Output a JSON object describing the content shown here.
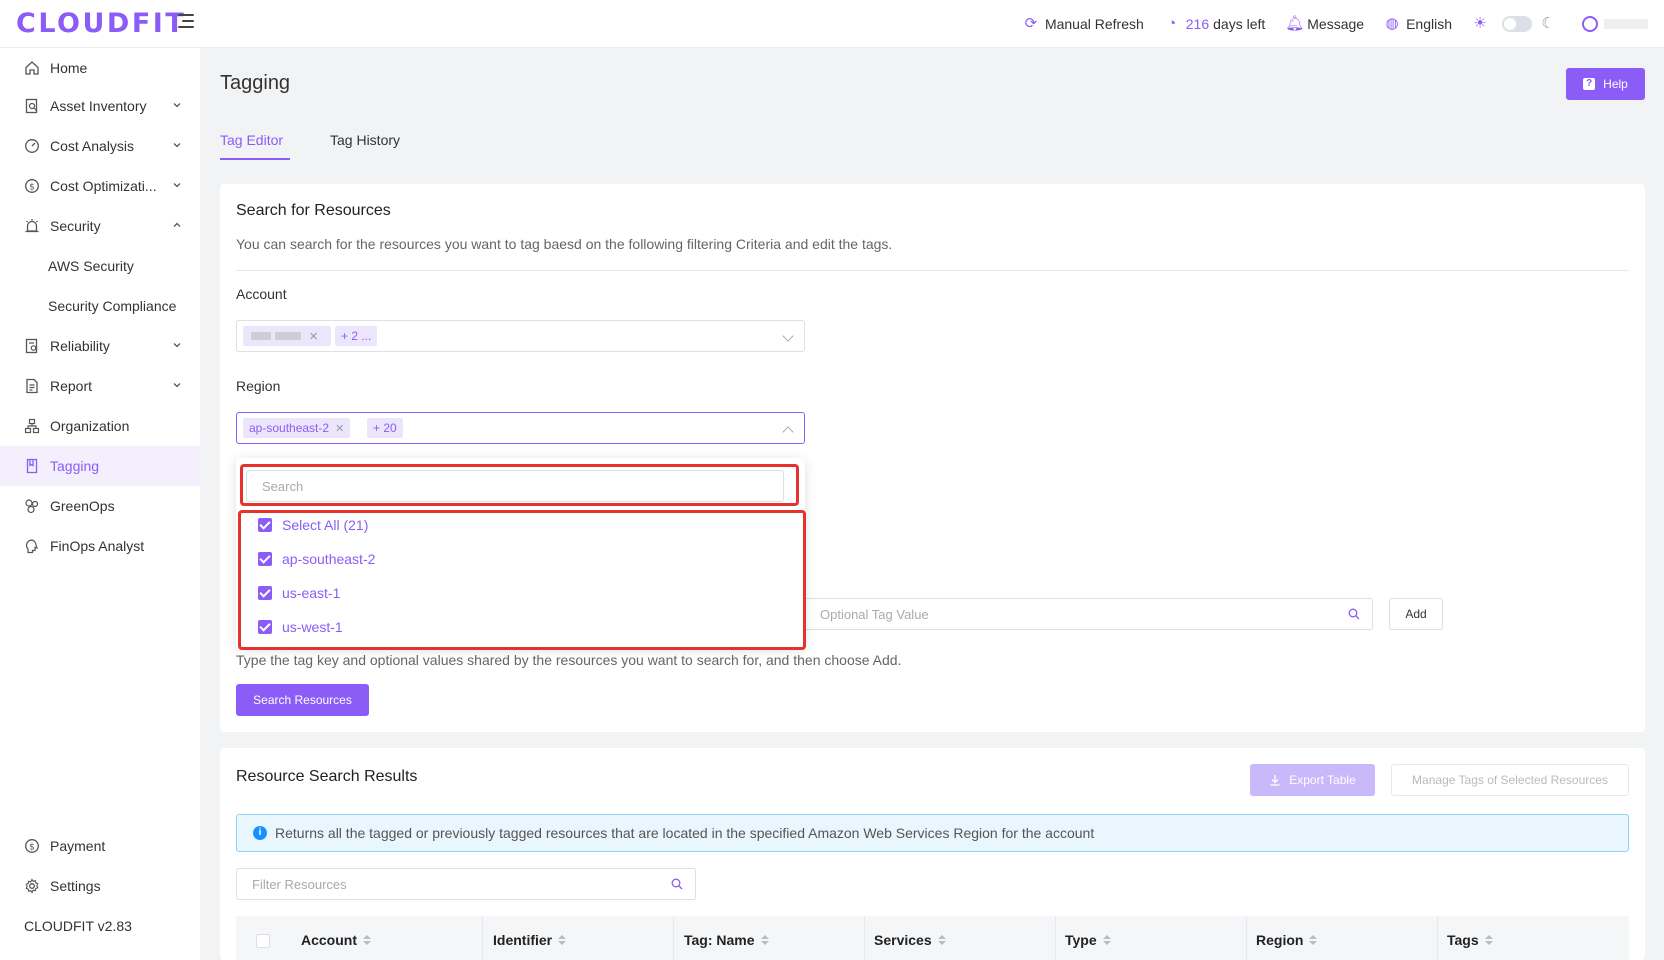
{
  "header": {
    "logo": "CLOUDFIT",
    "manual_refresh": "Manual Refresh",
    "days_value": "216",
    "days_suffix": "days left",
    "message": "Message",
    "language": "English"
  },
  "sidebar": {
    "items": [
      {
        "label": "Home",
        "icon": "home-icon"
      },
      {
        "label": "Asset Inventory",
        "icon": "inventory-icon"
      },
      {
        "label": "Cost Analysis",
        "icon": "gauge-icon"
      },
      {
        "label": "Cost Optimizati...",
        "icon": "dollar-icon"
      },
      {
        "label": "Security",
        "icon": "alarm-icon"
      },
      {
        "label": "AWS Security"
      },
      {
        "label": "Security Compliance"
      },
      {
        "label": "Reliability",
        "icon": "reliability-icon"
      },
      {
        "label": "Report",
        "icon": "report-icon"
      },
      {
        "label": "Organization",
        "icon": "org-icon"
      },
      {
        "label": "Tagging",
        "icon": "tag-icon"
      },
      {
        "label": "GreenOps",
        "icon": "greenops-icon"
      },
      {
        "label": "FinOps Analyst",
        "icon": "analyst-icon"
      }
    ],
    "payment": "Payment",
    "settings": "Settings",
    "version": "CLOUDFIT v2.83"
  },
  "page": {
    "title": "Tagging",
    "help": "Help",
    "tabs": [
      "Tag Editor",
      "Tag History"
    ]
  },
  "search": {
    "title": "Search for Resources",
    "description": "You can search for the resources you want to tag baesd on the following filtering Criteria and edit the tags.",
    "account_label": "Account",
    "account_more": "+ 2 ...",
    "region_label": "Region",
    "region_selected": "ap-southeast-2",
    "region_more": "+ 20",
    "dropdown": {
      "search_placeholder": "Search",
      "options": [
        "Select All (21)",
        "ap-southeast-2",
        "us-east-1",
        "us-west-1"
      ]
    },
    "tag_value_placeholder": "Optional Tag Value",
    "add_label": "Add",
    "hint": "Type the tag key and optional values shared by the resources you want to search for, and then choose Add.",
    "search_button": "Search Resources"
  },
  "results": {
    "title": "Resource Search Results",
    "export": "Export Table",
    "manage": "Manage Tags of Selected Resources",
    "info": "Returns all the tagged or previously tagged resources that are located in the specified Amazon Web Services Region for the account",
    "filter_placeholder": "Filter Resources",
    "columns": [
      "Account",
      "Identifier",
      "Tag: Name",
      "Services",
      "Type",
      "Region",
      "Tags"
    ]
  },
  "colors": {
    "accent": "#8b5cf6",
    "highlight": "#e5322d",
    "info": "#1890ff"
  }
}
